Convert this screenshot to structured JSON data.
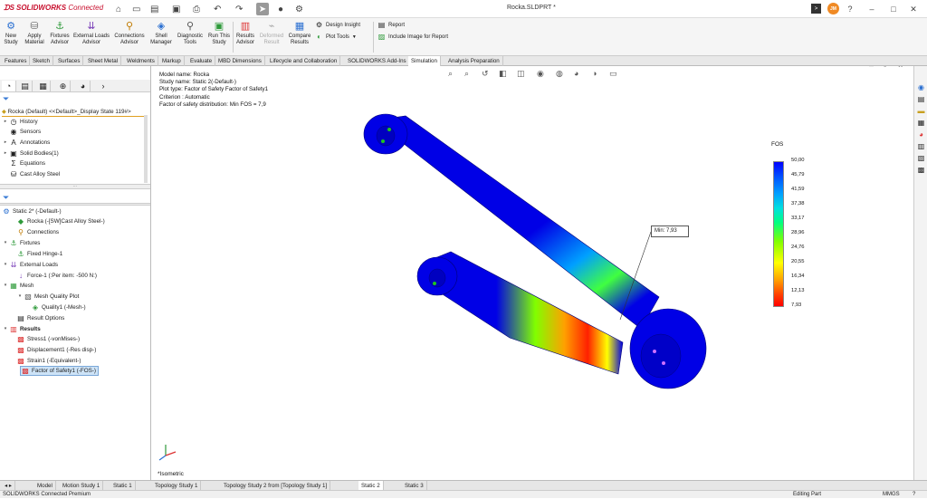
{
  "app": {
    "logo_text": "SOLIDWORKS",
    "logo_suffix": "Connected",
    "document_title": "Rocka.SLDPRT *",
    "user_initials": "JM"
  },
  "ribbon": {
    "new_study": "New Study",
    "apply_material": "Apply Material",
    "fixtures_advisor": "Fixtures Advisor",
    "external_loads_advisor": "External Loads Advisor",
    "connections_advisor": "Connections Advisor",
    "shell_manager": "Shell Manager",
    "diagnostic_tools": "Diagnostic Tools",
    "run_this_study": "Run This Study",
    "results_advisor": "Results Advisor",
    "deformed_result": "Deformed Result",
    "compare_results": "Compare Results",
    "design_insight": "Design Insight",
    "plot_tools": "Plot Tools",
    "report": "Report",
    "include_image": "Include Image for Report"
  },
  "command_tabs": [
    "Features",
    "Sketch",
    "Surfaces",
    "Sheet Metal",
    "Weldments",
    "Markup",
    "Evaluate",
    "MBD Dimensions",
    "Lifecycle and Collaboration",
    "SOLIDWORKS Add-Ins",
    "Simulation",
    "Analysis Preparation"
  ],
  "feature_tree": {
    "root": "Rocka (Default) <<Default>_Display State 119#>",
    "items": [
      "History",
      "Sensors",
      "Annotations",
      "Solid Bodies(1)",
      "Equations",
      "Cast Alloy Steel"
    ]
  },
  "sim_tree": {
    "items": [
      "Static 2* (-Default-)",
      "Rocka (-[SW]Cast Alloy Steel-)",
      "Connections",
      "Fixtures",
      "Fixed Hinge-1",
      "External Loads",
      "Force-1 (:Per item: -500 N:)",
      "Mesh",
      "Mesh Quality Plot",
      "Quality1 (-Mesh-)",
      "Result Options",
      "Results",
      "Stress1 (-vonMises-)",
      "Displacement1 (-Res disp-)",
      "Strain1 (-Equivalent-)",
      "Factor of Safety1 (-FOS-)"
    ]
  },
  "viewport": {
    "info": [
      "Model name: Rocka",
      "Study name: Static 2(-Default-)",
      "Plot type: Factor of Safety Factor of Safety1",
      "Criterion : Automatic",
      "Factor of safety distribution: Min FOS = 7,9"
    ],
    "legend_title": "FOS",
    "legend_values": [
      "50,00",
      "45,79",
      "41,59",
      "37,38",
      "33,17",
      "28,96",
      "24,76",
      "20,55",
      "16,34",
      "12,13",
      "7,93"
    ],
    "min_label": "Min:",
    "min_value": "7,93",
    "view_label": "*Isometric"
  },
  "bottom_tabs": [
    "Model",
    "Motion Study 1",
    "Static 1",
    "Topology Study 1",
    "Topology Study 2 from [Topology Study 1]",
    "Static 2",
    "Static 3"
  ],
  "status": {
    "left": "SOLIDWORKS Connected Premium",
    "mode": "Editing Part",
    "units": "MMGS"
  },
  "colors": {
    "brand": "#c8102e",
    "part_blue": "#0000e6",
    "highlight": "#cde3f7"
  }
}
